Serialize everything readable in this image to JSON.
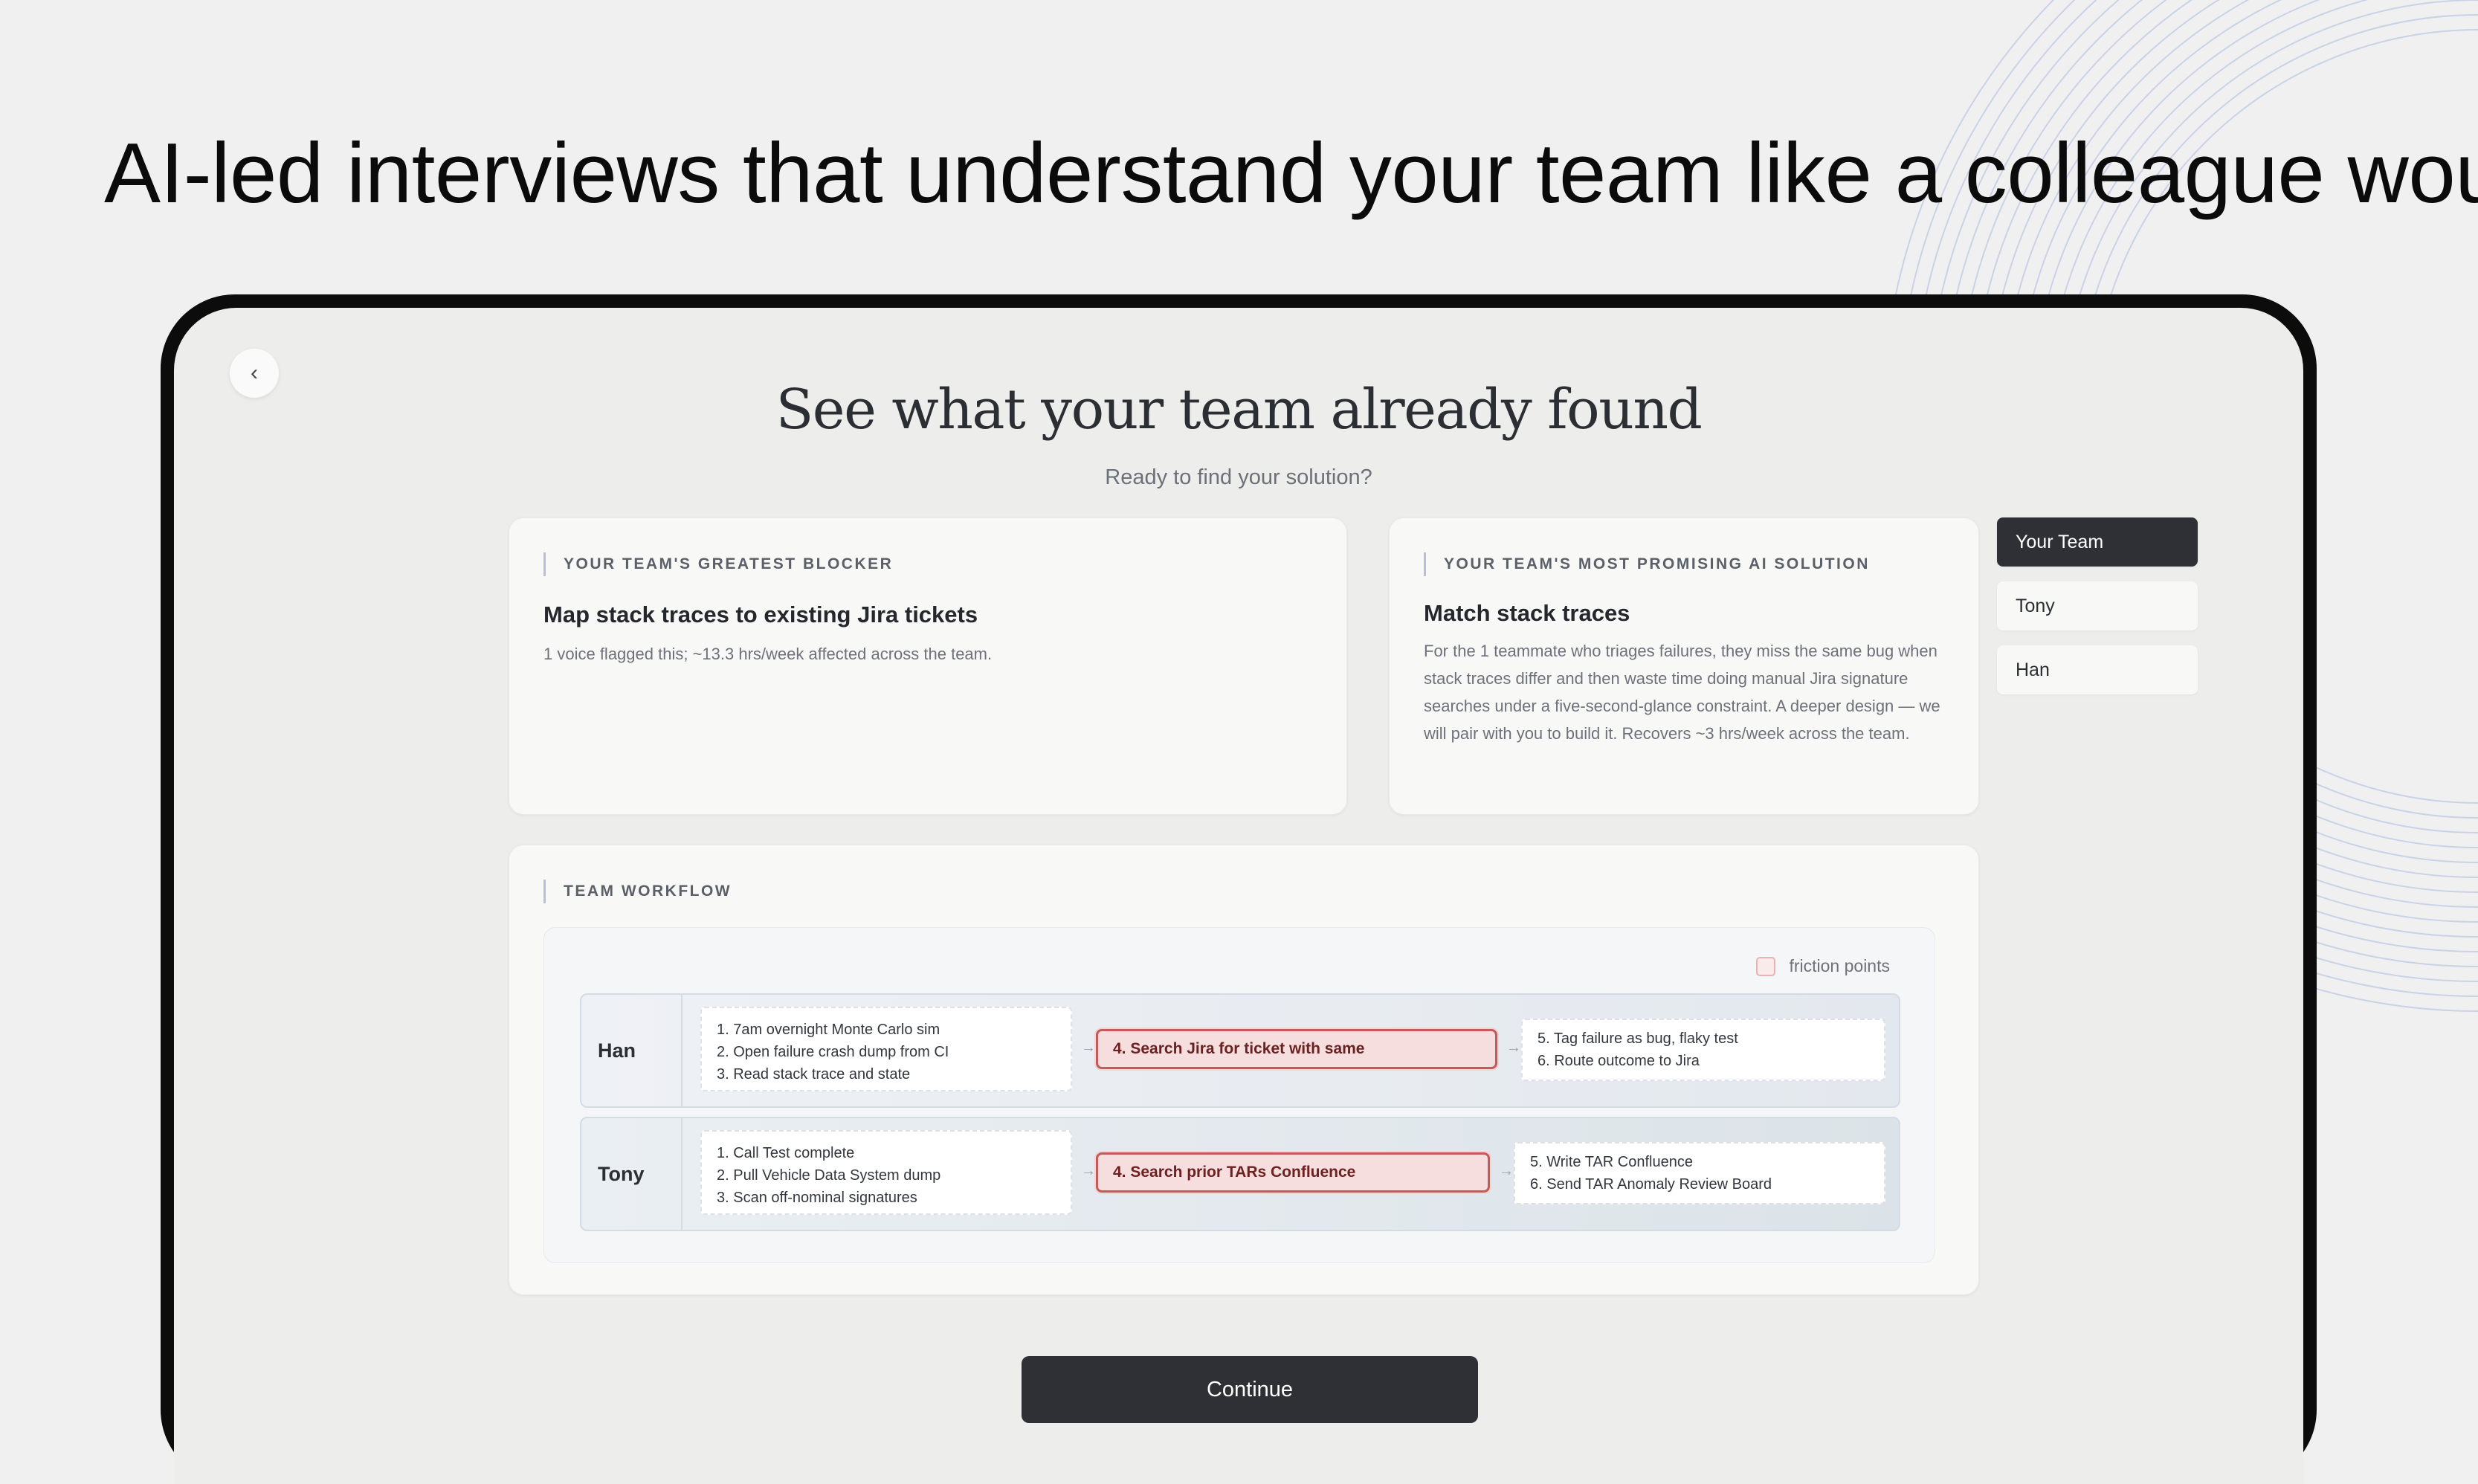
{
  "headline": "AI-led interviews that understand your team like a colleague would",
  "page": {
    "title": "See what your team already found",
    "subtitle": "Ready to find your solution?"
  },
  "blocker": {
    "label": "YOUR TEAM'S GREATEST BLOCKER",
    "heading": "Map stack traces to existing Jira tickets",
    "body": "1 voice flagged this; ~13.3 hrs/week affected across the team."
  },
  "solution": {
    "label": "YOUR TEAM'S MOST PROMISING AI SOLUTION",
    "heading": "Match stack traces",
    "body": "For the 1 teammate who triages failures, they miss the same bug when stack traces differ and then waste time doing manual Jira signature searches under a five-second-glance constraint. A deeper design — we will pair with you to build it. Recovers ~3 hrs/week across the team."
  },
  "team_nav": {
    "items": [
      {
        "label": "Your Team",
        "active": true
      },
      {
        "label": "Tony",
        "active": false
      },
      {
        "label": "Han",
        "active": false
      }
    ]
  },
  "workflow": {
    "label": "TEAM WORKFLOW",
    "friction_toggle": "friction points",
    "lanes": [
      {
        "name": "Han",
        "steps_before": [
          "1. 7am overnight Monte Carlo sim",
          "2. Open failure crash dump from CI",
          "3. Read stack trace and state"
        ],
        "friction_step": "4. Search Jira for ticket with same",
        "steps_after": [
          "5. Tag failure as bug, flaky test",
          "6. Route outcome to Jira"
        ]
      },
      {
        "name": "Tony",
        "steps_before": [
          "1. Call Test complete",
          "2. Pull Vehicle Data System dump",
          "3. Scan off-nominal signatures"
        ],
        "friction_step": "4. Search prior TARs Confluence",
        "steps_after": [
          "5. Write TAR Confluence",
          "6. Send TAR Anomaly Review Board"
        ]
      }
    ]
  },
  "continue_label": "Continue",
  "icons": {
    "back": "chevron-left-icon",
    "arrow": "arrow-right-icon"
  },
  "colors": {
    "accent_dark": "#2e3036",
    "friction_red": "#c45a5a",
    "friction_fill": "#f6dede"
  }
}
